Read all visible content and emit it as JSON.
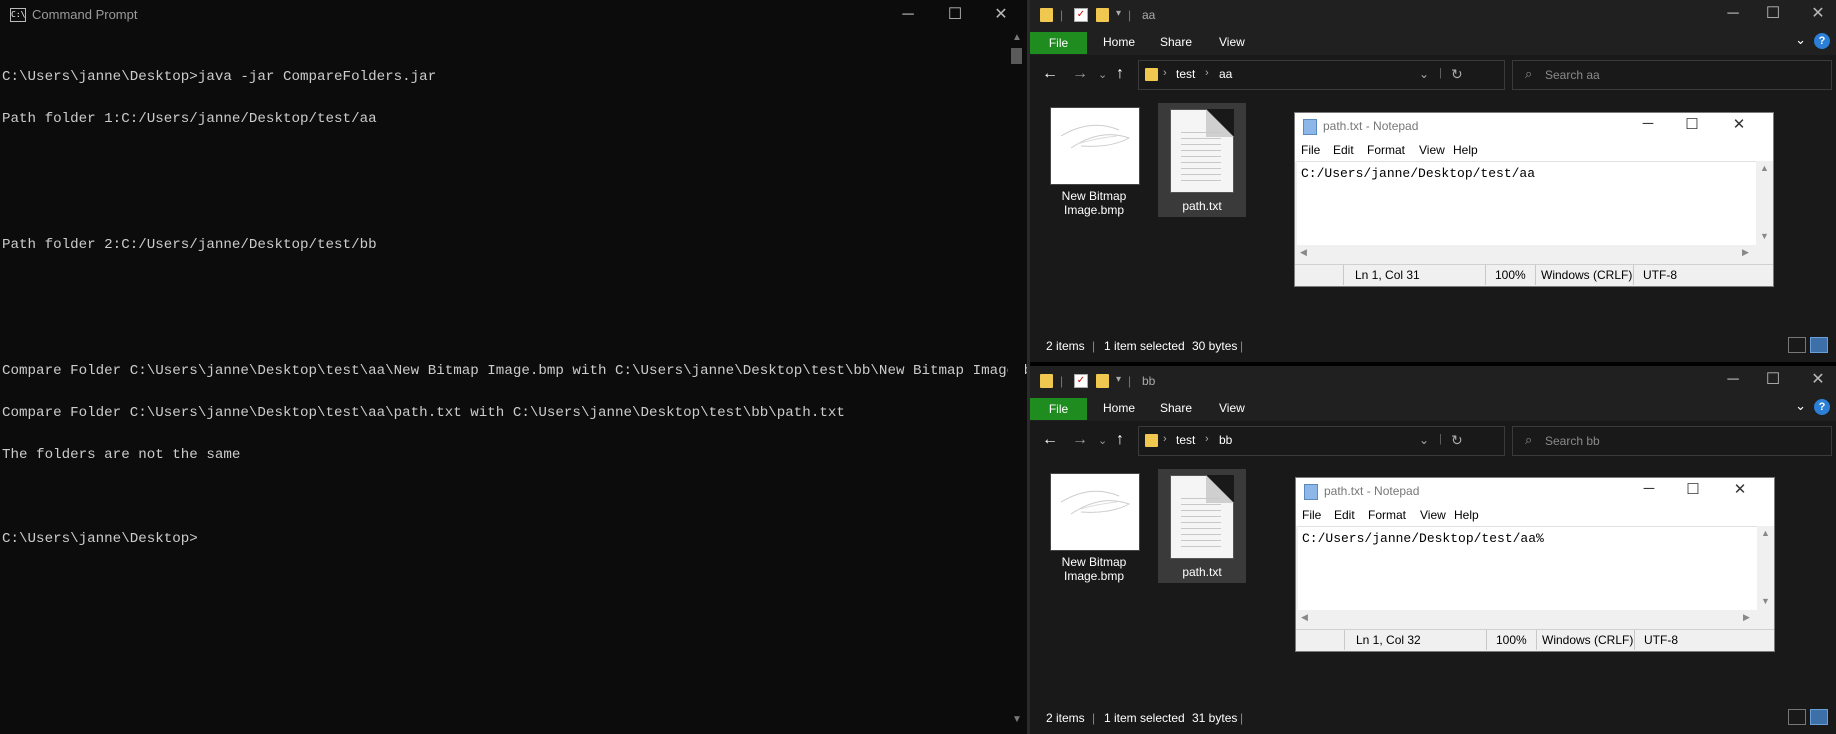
{
  "cmd": {
    "title": "Command Prompt",
    "icon": "C:\\",
    "lines": [
      "C:\\Users\\janne\\Desktop>java -jar CompareFolders.jar",
      "Path folder 1:C:/Users/janne/Desktop/test/aa",
      "",
      "",
      "Path folder 2:C:/Users/janne/Desktop/test/bb",
      "",
      "",
      "Compare Folder C:\\Users\\janne\\Desktop\\test\\aa\\New Bitmap Image.bmp with C:\\Users\\janne\\Desktop\\test\\bb\\New Bitmap Image.bmp",
      "Compare Folder C:\\Users\\janne\\Desktop\\test\\aa\\path.txt with C:\\Users\\janne\\Desktop\\test\\bb\\path.txt",
      "The folders are not the same",
      "",
      "C:\\Users\\janne\\Desktop>"
    ]
  },
  "explorer_top": {
    "title": "aa",
    "ribbon": {
      "file": "File",
      "home": "Home",
      "share": "Share",
      "view": "View",
      "help": "?"
    },
    "address": {
      "seg1": "test",
      "seg2": "aa"
    },
    "search_placeholder": "Search aa",
    "files": [
      {
        "name_line1": "New Bitmap",
        "name_line2": "Image.bmp"
      },
      {
        "name_line1": "path.txt",
        "name_line2": ""
      }
    ],
    "status": {
      "items": "2 items",
      "selected": "1 item selected",
      "size": "30 bytes"
    },
    "notepad": {
      "title": "path.txt - Notepad",
      "menu": [
        "File",
        "Edit",
        "Format",
        "View",
        "Help"
      ],
      "content": "C:/Users/janne/Desktop/test/aa",
      "status": {
        "position": "Ln 1, Col 31",
        "zoom": "100%",
        "eol": "Windows (CRLF)",
        "encoding": "UTF-8"
      }
    }
  },
  "explorer_bottom": {
    "title": "bb",
    "ribbon": {
      "file": "File",
      "home": "Home",
      "share": "Share",
      "view": "View",
      "help": "?"
    },
    "address": {
      "seg1": "test",
      "seg2": "bb"
    },
    "search_placeholder": "Search bb",
    "files": [
      {
        "name_line1": "New Bitmap",
        "name_line2": "Image.bmp"
      },
      {
        "name_line1": "path.txt",
        "name_line2": ""
      }
    ],
    "status": {
      "items": "2 items",
      "selected": "1 item selected",
      "size": "31 bytes"
    },
    "notepad": {
      "title": "path.txt - Notepad",
      "menu": [
        "File",
        "Edit",
        "Format",
        "View",
        "Help"
      ],
      "content": "C:/Users/janne/Desktop/test/aa%",
      "status": {
        "position": "Ln 1, Col 32",
        "zoom": "100%",
        "eol": "Windows (CRLF)",
        "encoding": "UTF-8"
      }
    }
  },
  "colors": {
    "file_tab": "#1f8c1f",
    "folder": "#f0c850",
    "console_bg": "#0c0c0c",
    "console_fg": "#cccccc"
  }
}
